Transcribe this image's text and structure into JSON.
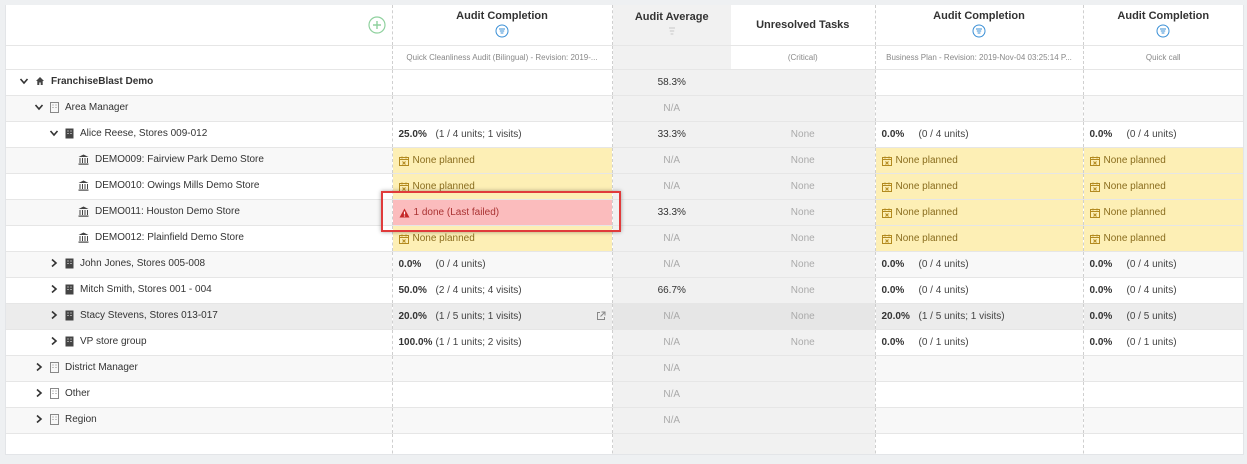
{
  "headers": {
    "col1": {
      "title": "Audit Completion",
      "sub": "Quick Cleanliness Audit (Bilingual) - Revision: 2019-..."
    },
    "col2": {
      "title": "Audit Average",
      "sub": ""
    },
    "col3": {
      "title": "Unresolved Tasks",
      "sub": "(Critical)"
    },
    "col4": {
      "title": "Audit Completion",
      "sub": "Business Plan - Revision: 2019-Nov-04 03:25:14 P..."
    },
    "col5": {
      "title": "Audit Completion",
      "sub": "Quick call"
    }
  },
  "rows": [
    {
      "name": "FranchiseBlast Demo",
      "c1": "",
      "c1u": "",
      "c2": "58.3%",
      "c3": "",
      "c4": "",
      "c4u": "",
      "c5": "",
      "c5u": ""
    },
    {
      "name": "Area Manager",
      "c1": "",
      "c1u": "",
      "c2": "N/A",
      "c3": "",
      "c4": "",
      "c4u": "",
      "c5": "",
      "c5u": ""
    },
    {
      "name": "Alice Reese, Stores 009-012",
      "c1": "25.0%",
      "c1u": "(1 / 4 units; 1 visits)",
      "c2": "33.3%",
      "c3": "None",
      "c4": "0.0%",
      "c4u": "(0 / 4 units)",
      "c5": "0.0%",
      "c5u": "(0 / 4 units)"
    },
    {
      "name": "DEMO009: Fairview Park Demo Store",
      "c1": "None planned",
      "c2": "N/A",
      "c3": "None",
      "c4": "None planned",
      "c5": "None planned"
    },
    {
      "name": "DEMO010: Owings Mills Demo Store",
      "c1": "None planned",
      "c2": "N/A",
      "c3": "None",
      "c4": "None planned",
      "c5": "None planned"
    },
    {
      "name": "DEMO011: Houston Demo Store",
      "c1": "1 done (Last failed)",
      "c2": "33.3%",
      "c3": "None",
      "c4": "None planned",
      "c5": "None planned"
    },
    {
      "name": "DEMO012: Plainfield Demo Store",
      "c1": "None planned",
      "c2": "N/A",
      "c3": "None",
      "c4": "None planned",
      "c5": "None planned"
    },
    {
      "name": "John Jones, Stores 005-008",
      "c1": "0.0%",
      "c1u": "(0 / 4 units)",
      "c2": "N/A",
      "c3": "None",
      "c4": "0.0%",
      "c4u": "(0 / 4 units)",
      "c5": "0.0%",
      "c5u": "(0 / 4 units)"
    },
    {
      "name": "Mitch Smith, Stores 001 - 004",
      "c1": "50.0%",
      "c1u": "(2 / 4 units; 4 visits)",
      "c2": "66.7%",
      "c3": "None",
      "c4": "0.0%",
      "c4u": "(0 / 4 units)",
      "c5": "0.0%",
      "c5u": "(0 / 4 units)"
    },
    {
      "name": "Stacy Stevens, Stores 013-017",
      "c1": "20.0%",
      "c1u": "(1 / 5 units; 1 visits)",
      "c2": "N/A",
      "c3": "None",
      "c4": "20.0%",
      "c4u": "(1 / 5 units; 1 visits)",
      "c5": "0.0%",
      "c5u": "(0 / 5 units)"
    },
    {
      "name": "VP store group",
      "c1": "100.0%",
      "c1u": "(1 / 1 units; 2 visits)",
      "c2": "N/A",
      "c3": "None",
      "c4": "0.0%",
      "c4u": "(0 / 1 units)",
      "c5": "0.0%",
      "c5u": "(0 / 1 units)"
    },
    {
      "name": "District Manager",
      "c2": "N/A"
    },
    {
      "name": "Other",
      "c2": "N/A"
    },
    {
      "name": "Region",
      "c2": "N/A"
    }
  ],
  "colors": {
    "planned": "#fdefb5",
    "failed": "#fbbcbd",
    "accent": "#3a8fd6",
    "add": "#8fd19e",
    "highlight": "#e03b3b"
  }
}
